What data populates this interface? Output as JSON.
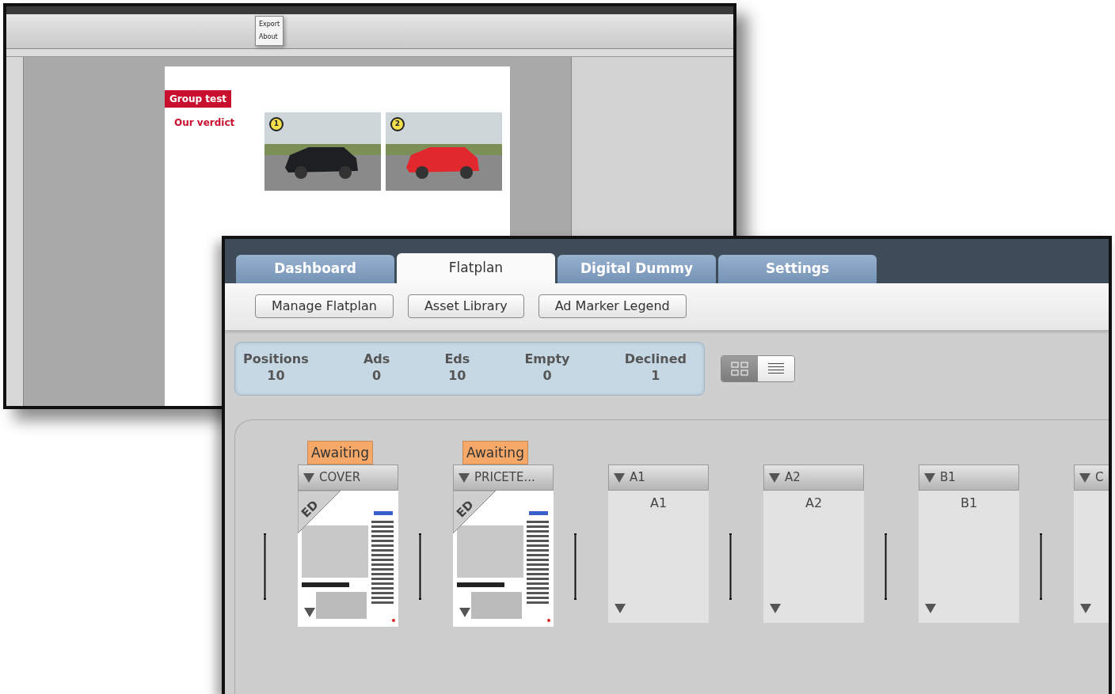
{
  "indesign_window": {
    "menu_items": [
      "Export",
      "About"
    ],
    "page": {
      "section_tag": "Group test",
      "heading": "Our verdict",
      "photos": [
        {
          "badge": "1"
        },
        {
          "badge": "2"
        }
      ]
    }
  },
  "flatplan_window": {
    "tabs": [
      {
        "label": "Dashboard",
        "selected": false
      },
      {
        "label": "Flatplan",
        "selected": true
      },
      {
        "label": "Digital Dummy",
        "selected": false
      },
      {
        "label": "Settings",
        "selected": false
      }
    ],
    "buttons": [
      "Manage Flatplan",
      "Asset Library",
      "Ad Marker Legend"
    ],
    "stats": [
      {
        "label": "Positions",
        "value": "10"
      },
      {
        "label": "Ads",
        "value": "0"
      },
      {
        "label": "Eds",
        "value": "10"
      },
      {
        "label": "Empty",
        "value": "0"
      },
      {
        "label": "Declined",
        "value": "1"
      }
    ],
    "view_toggle": [
      {
        "kind": "grid",
        "selected": true
      },
      {
        "kind": "list",
        "selected": false
      }
    ],
    "pages": [
      {
        "kind": "thumbnail",
        "status": "Awaiting",
        "title": "COVER",
        "type": "ED"
      },
      {
        "kind": "thumbnail",
        "status": "Awaiting",
        "title": "PRICETE...",
        "type": "ED"
      },
      {
        "kind": "empty",
        "title": "A1",
        "label": "A1"
      },
      {
        "kind": "empty",
        "title": "A2",
        "label": "A2"
      },
      {
        "kind": "empty",
        "title": "B1",
        "label": "B1"
      },
      {
        "kind": "empty",
        "title": "C"
      }
    ]
  }
}
